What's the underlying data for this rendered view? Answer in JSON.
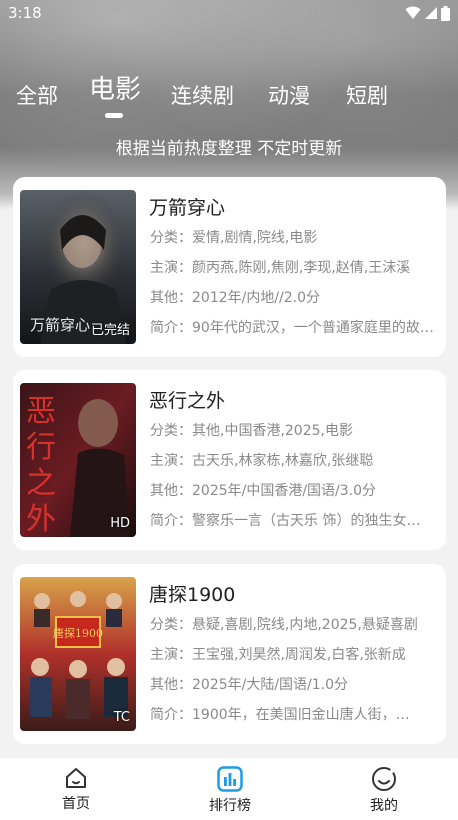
{
  "status": {
    "time": "3:18"
  },
  "tabs": [
    {
      "label": "全部"
    },
    {
      "label": "电影"
    },
    {
      "label": "连续剧"
    },
    {
      "label": "动漫"
    },
    {
      "label": "短剧"
    }
  ],
  "subtitle": "根据当前热度整理 不定时更新",
  "movies": [
    {
      "title": "万箭穿心",
      "category": "分类：爱情,剧情,院线,电影",
      "cast": "主演：颜丙燕,陈刚,焦刚,李现,赵倩,王沫溪",
      "other": "其他：2012年/内地//2.0分",
      "intro": "简介：90年代的武汉，一个普通家庭里的故事…",
      "badge": "已完结",
      "poster_text": "万箭穿心"
    },
    {
      "title": "恶行之外",
      "category": "分类：其他,中国香港,2025,电影",
      "cast": "主演：古天乐,林家栋,林嘉欣,张继聪",
      "other": "其他：2025年/中国香港/国语/3.0分",
      "intro": "简介：警察乐一言（古天乐 饰）的独生女…",
      "badge": "HD",
      "poster_text": "恶行之外"
    },
    {
      "title": "唐探1900",
      "category": "分类：悬疑,喜剧,院线,内地,2025,悬疑喜剧",
      "cast": "主演：王宝强,刘昊然,周润发,白客,张新成",
      "other": "其他：2025年/大陆/国语/1.0分",
      "intro": "简介：1900年，在美国旧金山唐人街，…",
      "badge": "TC",
      "poster_text": "唐探1900"
    }
  ],
  "nav": [
    {
      "label": "首页",
      "icon": "home-icon"
    },
    {
      "label": "排行榜",
      "icon": "chart-icon"
    },
    {
      "label": "我的",
      "icon": "profile-icon"
    }
  ],
  "colors": {
    "accent": "#1e9be6",
    "card_bg": "#ffffff",
    "page_bg": "#f2f2f2"
  }
}
